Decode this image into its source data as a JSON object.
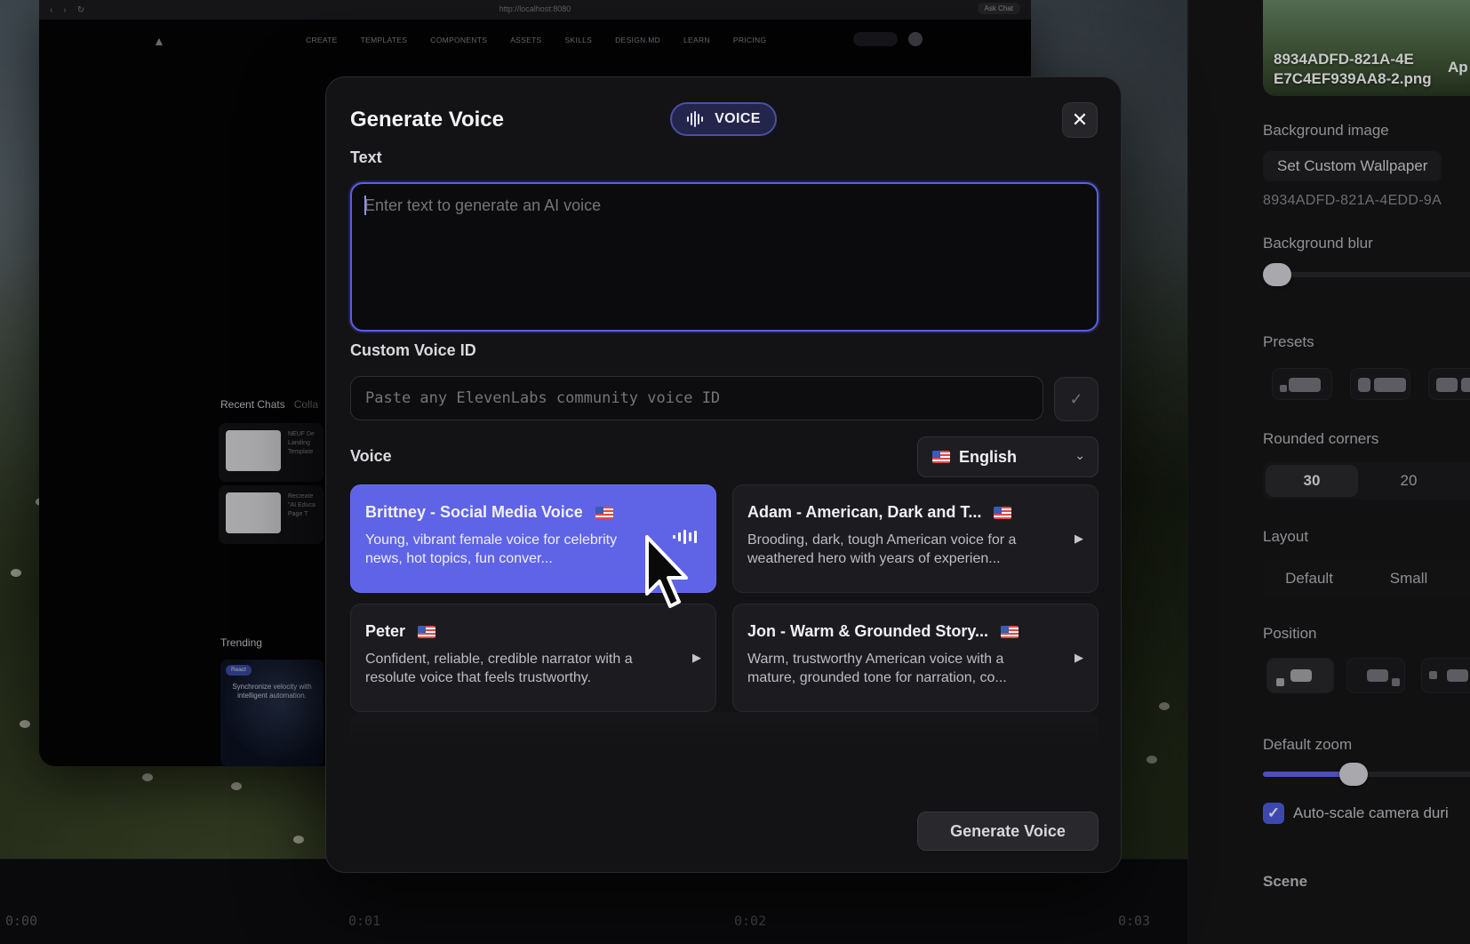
{
  "browser": {
    "url": "http://localhost:8080",
    "ask_chat": "Ask Chat",
    "nav_items": [
      "CREATE",
      "TEMPLATES",
      "COMPONENTS",
      "ASSETS",
      "SKILLS",
      "DESIGN.MD",
      "LEARN",
      "PRICING"
    ],
    "recent_chats_label": "Recent Chats",
    "collab_label": "Colla",
    "chat_cards": [
      {
        "title": "NEUF De Landing Template"
      },
      {
        "title": "Recreate \"AI Educa Page T"
      }
    ],
    "trending_label": "Trending",
    "trending_card": {
      "badge": "React",
      "text": "Synchronize velocity with intelligent automation."
    }
  },
  "modal": {
    "title": "Generate Voice",
    "badge_label": "VOICE",
    "text_label": "Text",
    "text_placeholder": "Enter text to generate an AI voice",
    "custom_voice_label": "Custom Voice ID",
    "custom_voice_placeholder": "Paste any ElevenLabs community voice ID",
    "voice_label": "Voice",
    "language": "English",
    "voices": [
      {
        "name": "Brittney - Social Media Voice",
        "description": "Young, vibrant female voice for celebrity news, hot topics, fun conver...",
        "selected": true
      },
      {
        "name": "Adam - American, Dark and T...",
        "description": "Brooding, dark, tough American voice for a weathered hero with years of experien...",
        "selected": false
      },
      {
        "name": "Peter",
        "description": "Confident, reliable, credible narrator with a resolute voice that feels trustworthy.",
        "selected": false
      },
      {
        "name": "Jon - Warm & Grounded Story...",
        "description": "Warm, trustworthy American voice with a mature, grounded tone for narration, co...",
        "selected": false
      }
    ],
    "generate_button": "Generate Voice"
  },
  "settings_panel": {
    "thumbnail_caption_line1": "8934ADFD-821A-4E",
    "thumbnail_caption_line2": "E7C4EF939AA8-2.png",
    "thumbnail_app": "Ap",
    "background_image_label": "Background image",
    "set_wallpaper_button": "Set Custom Wallpaper",
    "wallpaper_id": "8934ADFD-821A-4EDD-9A",
    "background_blur_label": "Background blur",
    "background_blur_value": 0,
    "presets_label": "Presets",
    "rounded_corners_label": "Rounded corners",
    "rounded_corners_options": [
      "30",
      "20"
    ],
    "layout_label": "Layout",
    "layout_options": [
      "Default",
      "Small"
    ],
    "position_label": "Position",
    "default_zoom_label": "Default zoom",
    "auto_scale_label": "Auto-scale camera duri",
    "auto_scale_checked": true,
    "scene_label": "Scene"
  },
  "timeline": {
    "ticks": [
      "0:00",
      "0:01",
      "0:02",
      "0:03"
    ]
  },
  "colors": {
    "accent": "#5f63e6",
    "focus_border": "#5b5fe2"
  }
}
